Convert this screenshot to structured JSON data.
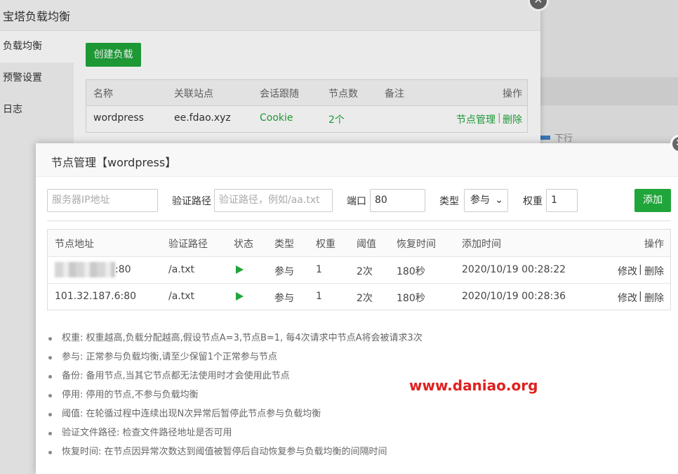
{
  "background": {
    "legend_text": "下行"
  },
  "outer_dialog": {
    "title": "宝塔负载均衡",
    "close_glyph": "✕",
    "sidebar": [
      {
        "label": "负载均衡"
      },
      {
        "label": "预警设置"
      },
      {
        "label": "日志"
      }
    ],
    "create_label": "创建负载",
    "table": {
      "headers": [
        "名称",
        "关联站点",
        "会话跟随",
        "节点数",
        "备注",
        "操作"
      ],
      "row": {
        "name": "wordpress",
        "site": "ee.fdao.xyz",
        "session": "Cookie",
        "nodes": "2个",
        "remark": "",
        "action_manage": "节点管理",
        "action_sep": "|",
        "action_delete": "删除"
      }
    }
  },
  "node_dialog": {
    "title": "节点管理【wordpress】",
    "close_glyph": "✕",
    "form": {
      "ip_placeholder": "服务器IP地址",
      "path_label": "验证路径",
      "path_placeholder": "验证路径，例如/aa.txt",
      "port_label": "端口",
      "port_value": "80",
      "type_label": "类型",
      "type_value": "参与",
      "weight_label": "权重",
      "weight_value": "1",
      "add_label": "添加"
    },
    "table": {
      "headers": [
        "节点地址",
        "验证路径",
        "状态",
        "类型",
        "权重",
        "阈值",
        "恢复时间",
        "添加时间",
        "操作"
      ],
      "rows": [
        {
          "address": ":80",
          "path": "/a.txt",
          "type": "参与",
          "weight": "1",
          "threshold": "2次",
          "recovery": "180秒",
          "added": "2020/10/19 00:28:22",
          "edit": "修改",
          "sep": "|",
          "delete": "删除"
        },
        {
          "address": "101.32.187.6:80",
          "path": "/a.txt",
          "type": "参与",
          "weight": "1",
          "threshold": "2次",
          "recovery": "180秒",
          "added": "2020/10/19 00:28:36",
          "edit": "修改",
          "sep": "|",
          "delete": "删除"
        }
      ]
    },
    "notes": [
      "权重: 权重越高,负载分配越高,假设节点A=3,节点B=1, 每4次请求中节点A将会被请求3次",
      "参与: 正常参与负载均衡,请至少保留1个正常参与节点",
      "备份: 备用节点,当其它节点都无法使用时才会使用此节点",
      "停用: 停用的节点,不参与负载均衡",
      "阈值: 在轮循过程中连续出现N次异常后暂停此节点参与负载均衡",
      "验证文件路径: 检查文件路径地址是否可用",
      "恢复时间: 在节点因异常次数达到阈值被暂停后自动恢复参与负载均衡的间隔时间"
    ],
    "watermark": "www.daniao.org"
  }
}
